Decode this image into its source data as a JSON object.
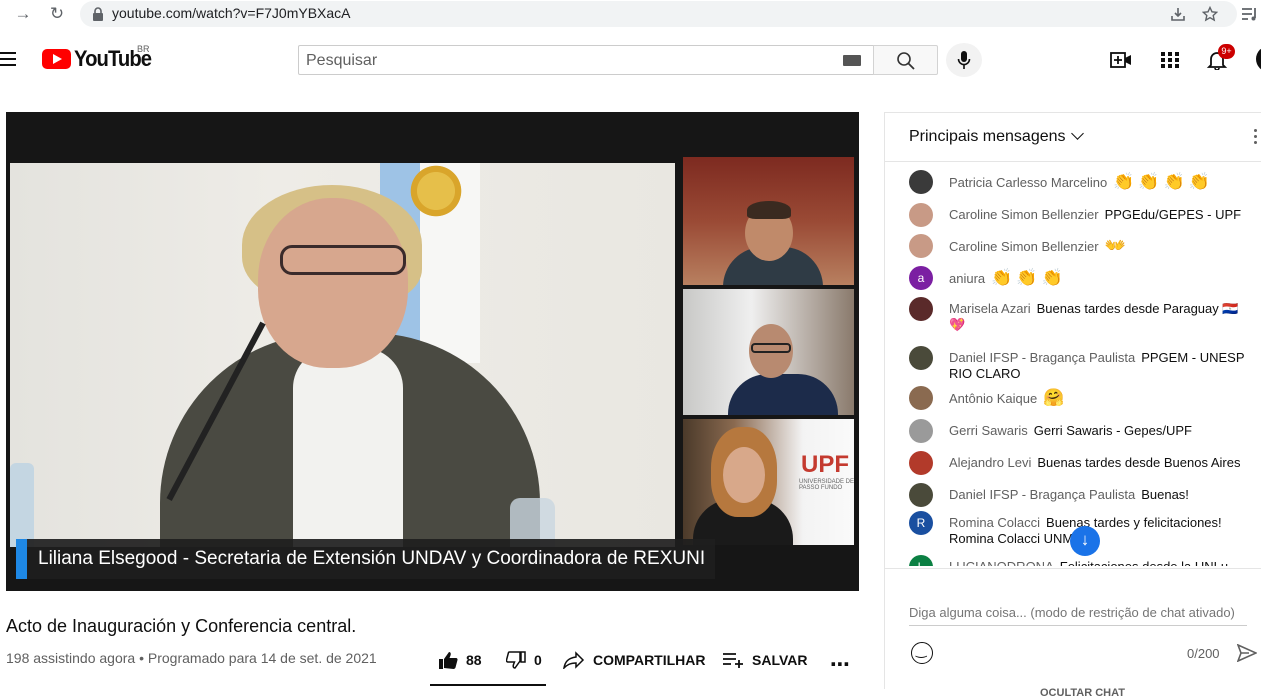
{
  "browser": {
    "url": "youtube.com/watch?v=F7J0mYBXacA"
  },
  "header": {
    "logo_text": "YouTube",
    "region": "BR",
    "search_placeholder": "Pesquisar",
    "notification_badge": "9+"
  },
  "video": {
    "lower_third": "Liliana Elsegood - Secretaria de Extensión UNDAV y Coordinadora de REXUNI",
    "upf_logo_text": "UPF",
    "upf_logo_subtext": "UNIVERSIDADE DE PASSO FUNDO",
    "title": "Acto de Inauguración y Conferencia central.",
    "meta": "198 assistindo agora • Programado para 14 de set. de 2021",
    "likes": "88",
    "dislikes": "0",
    "share_label": "COMPARTILHAR",
    "save_label": "SALVAR"
  },
  "chat": {
    "title": "Principais mensagens",
    "messages": [
      {
        "author": "Patricia Carlesso Marcelino",
        "text": "👏👏👏👏",
        "avatar_color": "#3a3a3a",
        "avatar_initial": ""
      },
      {
        "author": "Caroline Simon Bellenzier",
        "text": "PPGEdu/GEPES - UPF",
        "avatar_color": "#c89a86",
        "avatar_initial": ""
      },
      {
        "author": "Caroline Simon Bellenzier",
        "text": "👐",
        "avatar_color": "#c89a86",
        "avatar_initial": ""
      },
      {
        "author": "aniura",
        "text": "👏👏👏",
        "avatar_color": "#7b1fa2",
        "avatar_initial": "a"
      },
      {
        "author": "Marisela Azari",
        "text": "Buenas tardes desde Paraguay 🇵🇾 💖",
        "avatar_color": "#5a2a2a",
        "avatar_initial": ""
      },
      {
        "author": "Daniel IFSP - Bragança Paulista",
        "text": "PPGEM - UNESP RIO CLARO",
        "avatar_color": "#4a4a3a",
        "avatar_initial": ""
      },
      {
        "author": "Antônio Kaique",
        "text": "🤗",
        "avatar_color": "#8a6a50",
        "avatar_initial": ""
      },
      {
        "author": "Gerri Sawaris",
        "text": "Gerri Sawaris - Gepes/UPF",
        "avatar_color": "#9a9a9a",
        "avatar_initial": ""
      },
      {
        "author": "Alejandro Levi",
        "text": "Buenas tardes desde Buenos Aires",
        "avatar_color": "#b23a2a",
        "avatar_initial": ""
      },
      {
        "author": "Daniel IFSP - Bragança Paulista",
        "text": "Buenas!",
        "avatar_color": "#4a4a3a",
        "avatar_initial": ""
      },
      {
        "author": "Romina Colacci",
        "text": "Buenas tardes y felicitaciones! Romina Colacci UNM",
        "avatar_color": "#1a4fa0",
        "avatar_initial": "R"
      },
      {
        "author": "LUCIANODRONA",
        "text": "Felicitaciones desde la UNLu",
        "avatar_color": "#0b8043",
        "avatar_initial": "L"
      }
    ],
    "input_placeholder": "Diga alguma coisa... (modo de restrição de chat ativado)",
    "char_count": "0/200",
    "hide_chat_label": "OCULTAR CHAT"
  }
}
